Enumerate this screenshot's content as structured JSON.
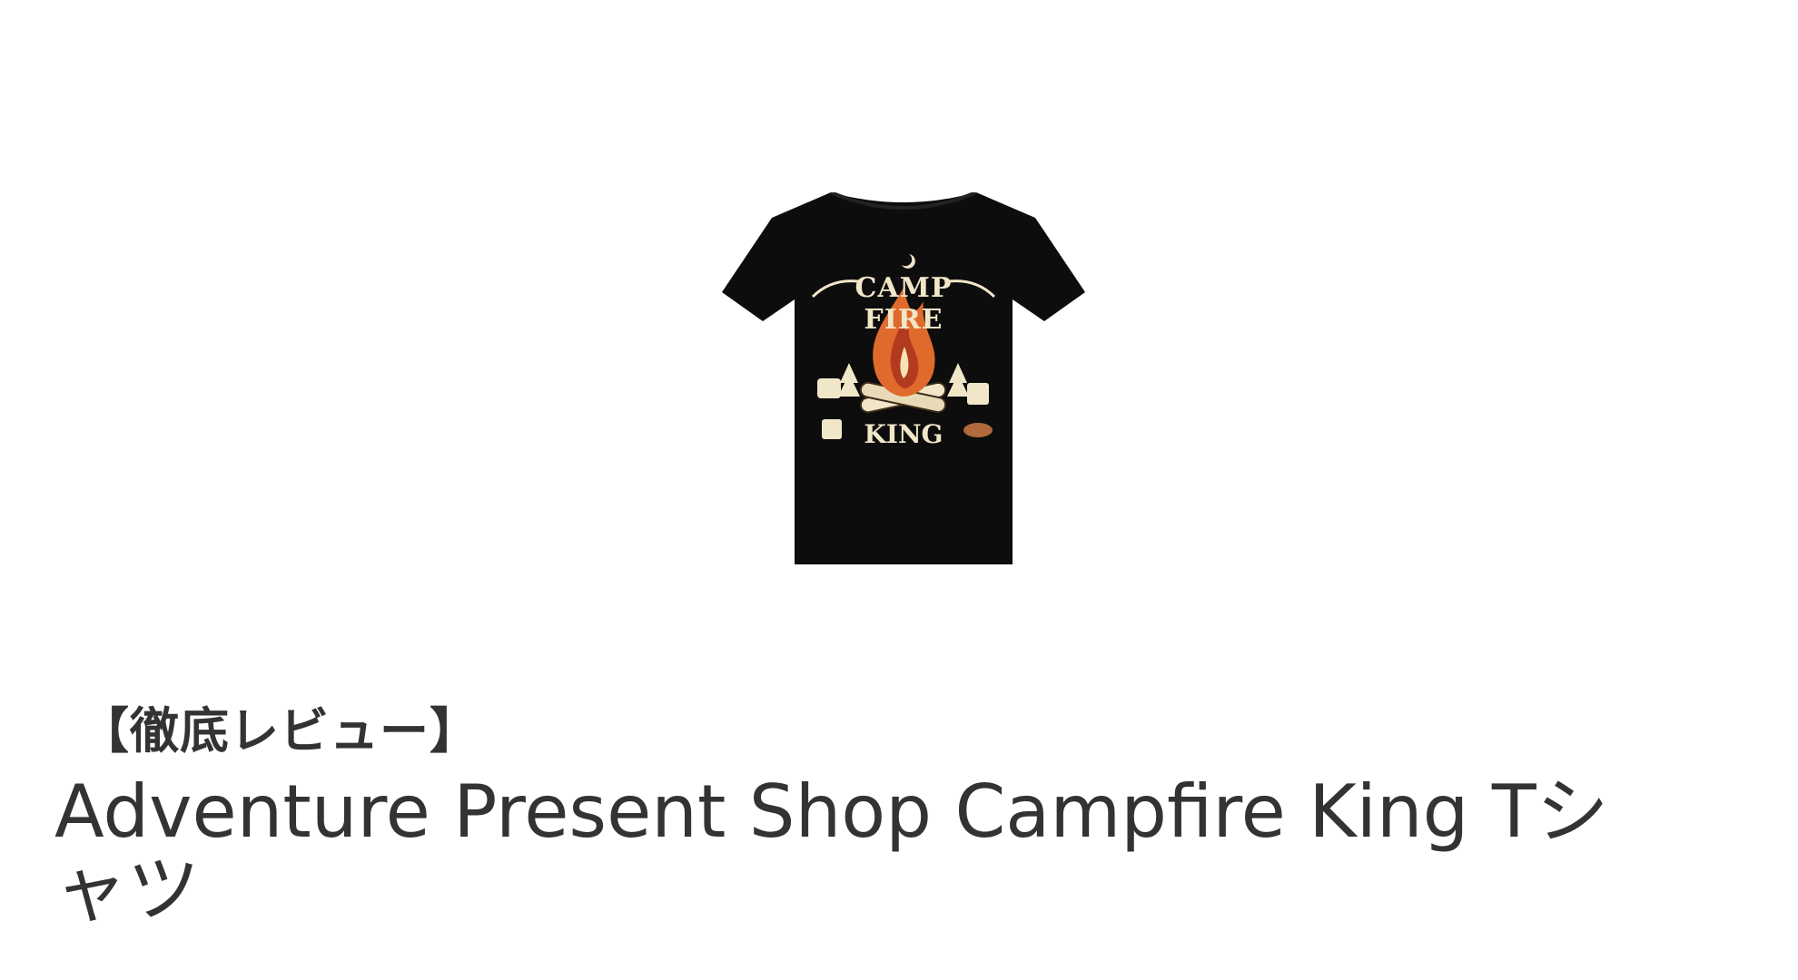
{
  "product": {
    "image_alt": "CAMP FIRE KING T-shirt",
    "print_text_top": "CAMP FIRE",
    "print_text_bottom": "KING",
    "shirt_color": "#0d0d0d",
    "print_cream": "#f1e6c8",
    "flame_orange": "#e06a2b",
    "flame_red": "#b23a1e"
  },
  "article": {
    "subtitle": "【徹底レビュー】",
    "title": "Adventure Present Shop Campfire King Tシャツ"
  }
}
